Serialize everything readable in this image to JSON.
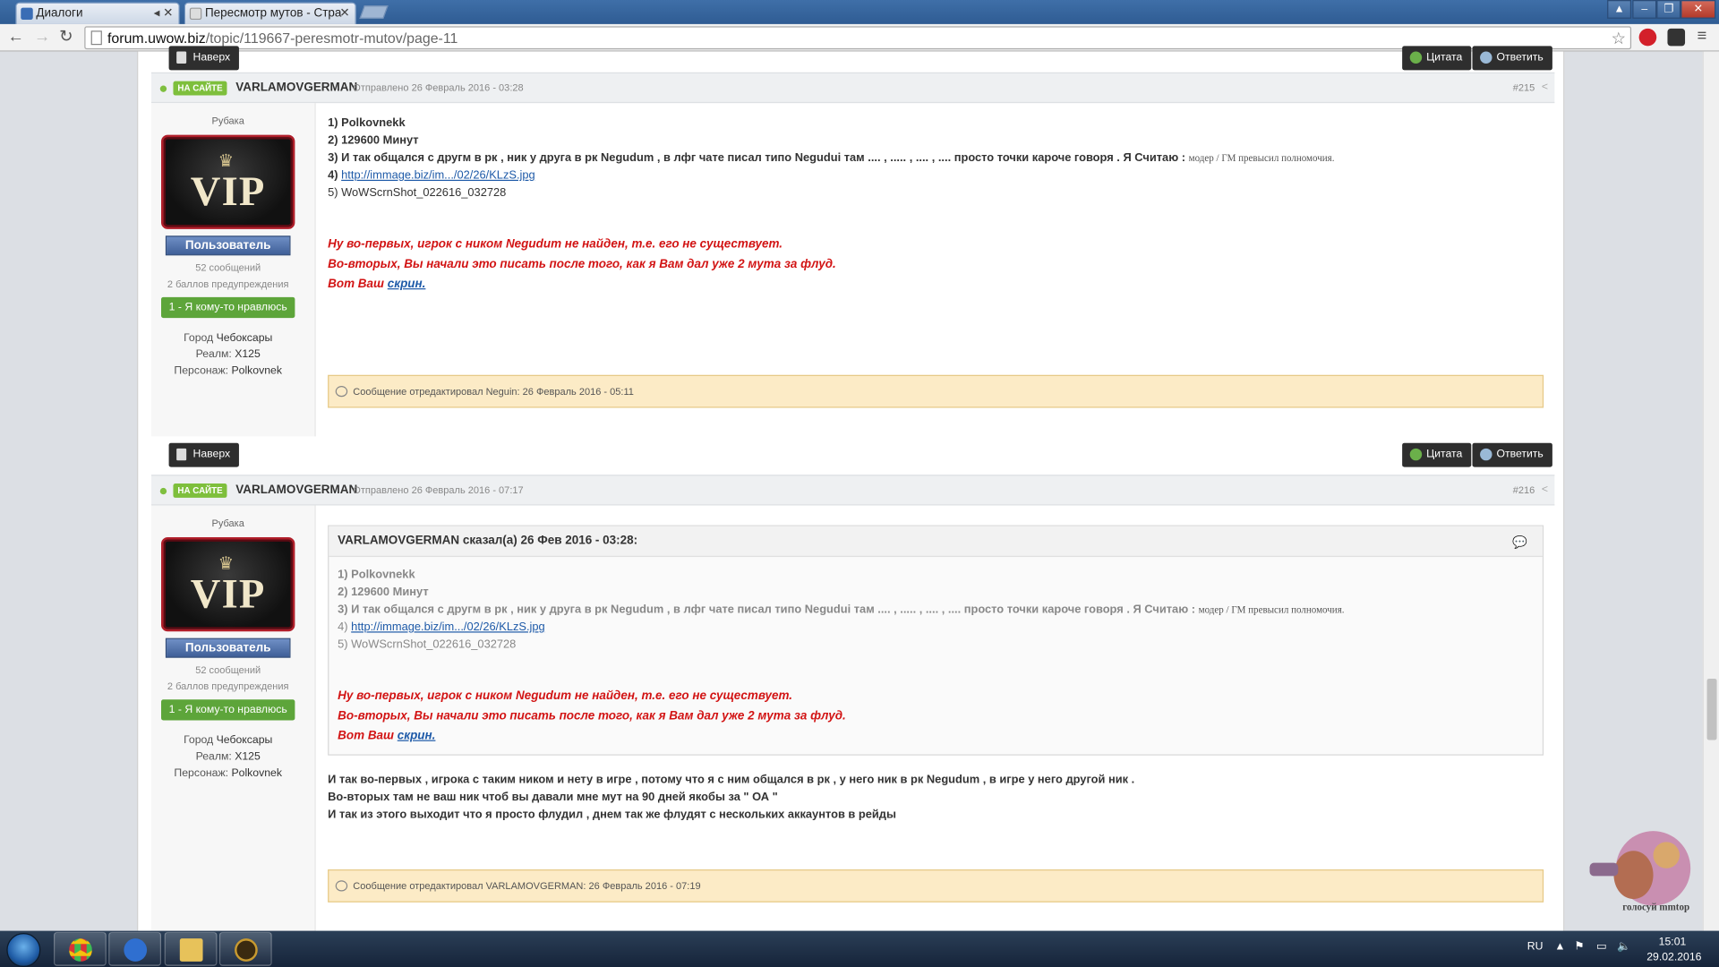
{
  "browser": {
    "tabs": [
      {
        "label": "Диалоги",
        "icon": "blue-tab-icon"
      },
      {
        "label": "Пересмотр мутов - Стра",
        "icon": "page-tab-icon"
      }
    ],
    "url_host": "forum.uwow.biz",
    "url_path": "/topic/119667-peresmotr-mutov/page-11"
  },
  "buttons": {
    "top": "Наверх",
    "quote": "Цитата",
    "reply": "Ответить"
  },
  "posts": [
    {
      "online": "НА САЙТЕ",
      "author": "VARLAMOVGERMAN",
      "posted": "Отправлено 26 Февраль 2016 - 03:28",
      "number": "#215",
      "rank": "Рубака",
      "badge": "VIP",
      "group": "Пользователь",
      "messages": "52 сообщений",
      "warnings": "2 баллов предупреждения",
      "likes": "1 - Я кому-то нравлюсь",
      "city_label": "Город",
      "city": "Чебоксары",
      "realm_label": "Реалм:",
      "realm": "X125",
      "char_label": "Персонаж:",
      "char": "Polkovnek",
      "lines": {
        "l1": "1) Polkovnekk",
        "l2": "2) 129600 Минут",
        "l3": "3) И так общался с другм в рк , ник у друга в рк Negudum , в лфг чате писал типо Negudui там .... , ..... , .... , .... просто точки кароче говоря .  Я Считаю : ",
        "l3small": "модер / ГМ превысил полномочия.",
        "l4num": "4) ",
        "l4link": "http://immage.biz/im.../02/26/KLzS.jpg",
        "l5": "5) WoWScrnShot_022616_032728"
      },
      "mod": {
        "m1": "Ну во-первых, игрок с ником Negudum не найден, т.е. его не существует.",
        "m2": "Во-вторых, Вы начали это писать после того, как я Вам дал уже 2 мута за флуд.",
        "m3": "Вот Ваш ",
        "m3link": "скрин."
      },
      "edited": "Сообщение отредактировал Neguin: 26 Февраль 2016 - 05:11"
    },
    {
      "online": "НА САЙТЕ",
      "author": "VARLAMOVGERMAN",
      "posted": "Отправлено 26 Февраль 2016 - 07:17",
      "number": "#216",
      "rank": "Рубака",
      "badge": "VIP",
      "group": "Пользователь",
      "messages": "52 сообщений",
      "warnings": "2 баллов предупреждения",
      "likes": "1 - Я кому-то нравлюсь",
      "city_label": "Город",
      "city": "Чебоксары",
      "realm_label": "Реалм:",
      "realm": "X125",
      "char_label": "Персонаж:",
      "char": "Polkovnek",
      "quote_head": "VARLAMOVGERMAN сказал(а) 26 Фев 2016 - 03:28:",
      "body": {
        "b1": "И так во-первых , игрока с таким ником и нету в игре , потому что я с ним общался в рк , у него ник в рк Negudum , в игре у него другой ник .",
        "b2": "Во-вторых там не ваш ник чтоб вы давали мне мут на 90 дней якобы за \" ОА \"",
        "b3": "И так из этого выходит что я просто флудил , днем так же флудят с нескольких аккаунтов в рейды"
      },
      "edited": "Сообщение отредактировал VARLAMOVGERMAN: 26 Февраль 2016 - 07:19"
    }
  ],
  "taskbar": {
    "lang": "RU",
    "time": "15:01",
    "date": "29.02.2016",
    "widget": "голосуй mmtop"
  },
  "colors": {
    "online": "#7ebf3c",
    "mod_text": "#d21414",
    "edit_bg": "#fcebc6",
    "like": "#5da53a"
  }
}
